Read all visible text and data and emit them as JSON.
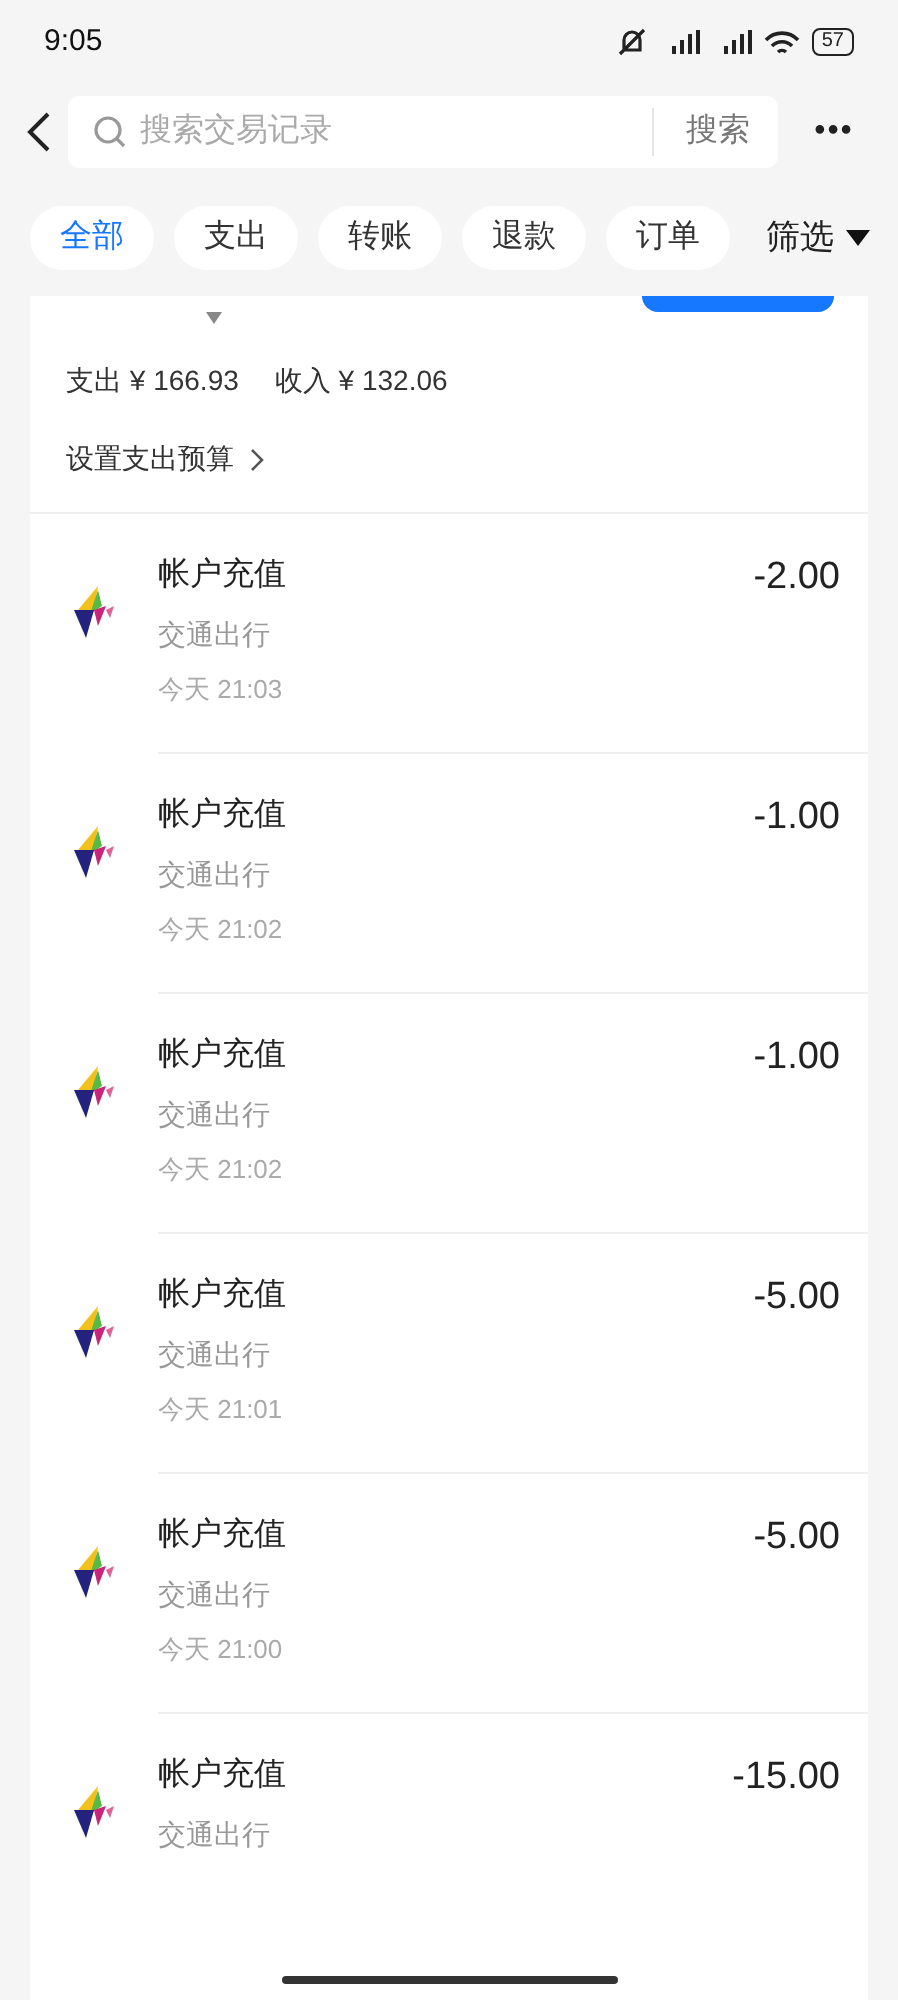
{
  "status_bar": {
    "time": "9:05",
    "battery": "57"
  },
  "search": {
    "placeholder": "搜索交易记录",
    "button": "搜索",
    "more": "•••"
  },
  "tabs": [
    {
      "label": "全部",
      "selected": true
    },
    {
      "label": "支出",
      "selected": false
    },
    {
      "label": "转账",
      "selected": false
    },
    {
      "label": "退款",
      "selected": false
    },
    {
      "label": "订单",
      "selected": false
    }
  ],
  "filter": {
    "label": "筛选"
  },
  "summary": {
    "expense": "支出 ¥ 166.93",
    "income": "收入 ¥ 132.06",
    "budget": "设置支出预算"
  },
  "transactions": [
    {
      "title": "帐户充值",
      "category": "交通出行",
      "time": "今天 21:03",
      "amount": "-2.00"
    },
    {
      "title": "帐户充值",
      "category": "交通出行",
      "time": "今天 21:02",
      "amount": "-1.00"
    },
    {
      "title": "帐户充值",
      "category": "交通出行",
      "time": "今天 21:02",
      "amount": "-1.00"
    },
    {
      "title": "帐户充值",
      "category": "交通出行",
      "time": "今天 21:01",
      "amount": "-5.00"
    },
    {
      "title": "帐户充值",
      "category": "交通出行",
      "time": "今天 21:00",
      "amount": "-5.00"
    },
    {
      "title": "帐户充值",
      "category": "交通出行",
      "amount": "-15.00"
    }
  ]
}
